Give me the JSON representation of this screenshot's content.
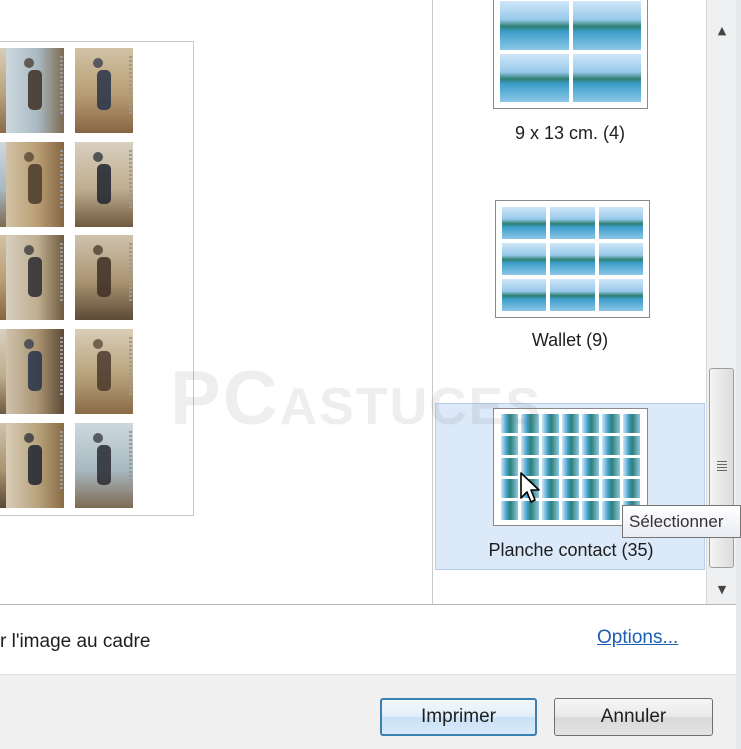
{
  "layouts": [
    {
      "label": "9 x 13 cm. (4)",
      "selected": false
    },
    {
      "label": "Wallet (9)",
      "selected": false
    },
    {
      "label": "Planche contact (35)",
      "selected": true
    }
  ],
  "tooltip": "Sélectionner",
  "options": {
    "fit_label": "r l'image au cadre",
    "link": "Options..."
  },
  "buttons": {
    "print": "Imprimer",
    "cancel": "Annuler"
  },
  "watermark": {
    "brand": "PC",
    "suffix": "ASTUCES"
  },
  "colors": {
    "selection": "#dbe9f9",
    "link": "#1a5fb4",
    "default_button": "#3c7fb1"
  },
  "icons": {
    "scroll_up": "scroll-up-arrow-icon",
    "scroll_down": "scroll-down-arrow-icon",
    "cursor": "mouse-pointer-icon"
  }
}
